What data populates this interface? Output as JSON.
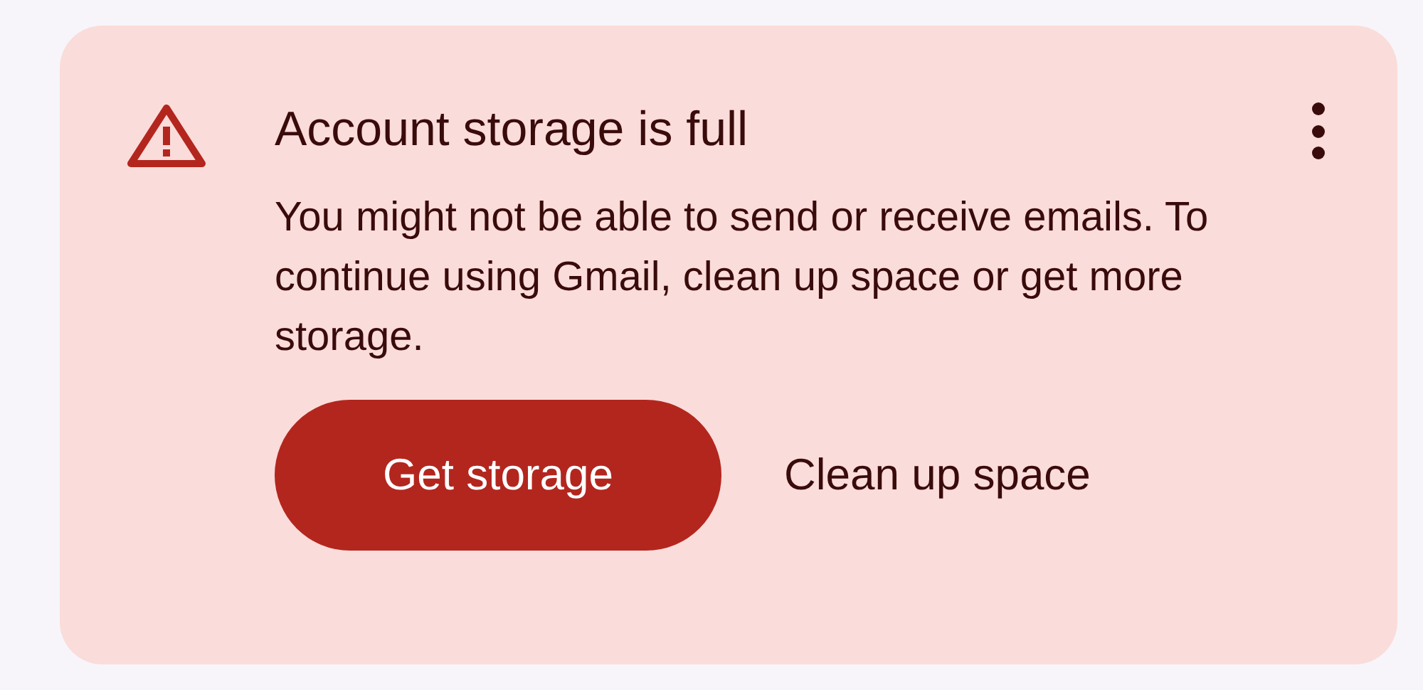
{
  "banner": {
    "title": "Account storage is full",
    "message": "You might not be able to send or receive emails. To continue using Gmail, clean up space or get more storage.",
    "buttons": [
      {
        "label": "Get storage",
        "kind": "filled"
      },
      {
        "label": "Clean up space",
        "kind": "text"
      }
    ]
  }
}
